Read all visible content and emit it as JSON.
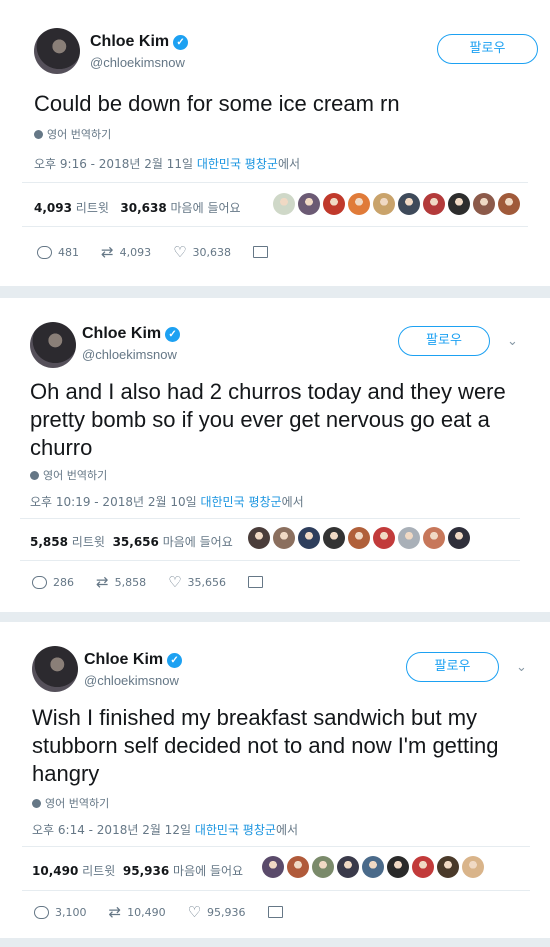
{
  "tweets": [
    {
      "name": "Chloe Kim",
      "handle": "@chloekimsnow",
      "follow_label": "팔로우",
      "text": "Could be down for some ice cream rn",
      "translate": "영어 번역하기",
      "time": "오후 9:16 - 2018년 2월 11일",
      "location": "대한민국 평창군",
      "location_suffix": "에서",
      "retweets": "4,093",
      "retweets_label": "리트윗",
      "likes": "30,638",
      "likes_label": "마음에 들어요",
      "reply_count": "481",
      "retweet_count": "4,093",
      "like_count": "30,638",
      "face_colors": [
        "#cfd8c8",
        "#6b5a74",
        "#c0392b",
        "#e07b39",
        "#c9a36b",
        "#3e4a5a",
        "#b33a3a",
        "#2d2d2d",
        "#8c5a4a",
        "#a05a3a"
      ]
    },
    {
      "name": "Chloe Kim",
      "handle": "@chloekimsnow",
      "follow_label": "팔로우",
      "text": "Oh and I also had 2 churros today and they were pretty bomb so if you ever get nervous go eat a churro",
      "translate": "영어 번역하기",
      "time": "오후 10:19 - 2018년 2월 10일",
      "location": "대한민국 평창군",
      "location_suffix": "에서",
      "retweets": "5,858",
      "retweets_label": "리트윗",
      "likes": "35,656",
      "likes_label": "마음에 들어요",
      "reply_count": "286",
      "retweet_count": "5,858",
      "like_count": "35,656",
      "face_colors": [
        "#4a3d3a",
        "#8b6f5e",
        "#2e3e5c",
        "#333333",
        "#b0603a",
        "#c23b3b",
        "#a9b0b8",
        "#c7775a",
        "#2f2f3a"
      ]
    },
    {
      "name": "Chloe Kim",
      "handle": "@chloekimsnow",
      "follow_label": "팔로우",
      "text": "Wish I finished my breakfast sandwich but my stubborn self decided not to and now I'm getting hangry",
      "translate": "영어 번역하기",
      "time": "오후 6:14 - 2018년 2월 12일",
      "location": "대한민국 평창군",
      "location_suffix": "에서",
      "retweets": "10,490",
      "retweets_label": "리트윗",
      "likes": "95,936",
      "likes_label": "마음에 들어요",
      "reply_count": "3,100",
      "retweet_count": "10,490",
      "like_count": "95,936",
      "face_colors": [
        "#5a4a6a",
        "#b05a3a",
        "#7a8a6a",
        "#3a3a4a",
        "#4a6a8a",
        "#2a2a2a",
        "#c23a3a",
        "#4a3a2a",
        "#d9b48a"
      ]
    }
  ],
  "colors": {
    "accent": "#1da1f2",
    "link": "#1b95e0",
    "muted": "#657786"
  }
}
